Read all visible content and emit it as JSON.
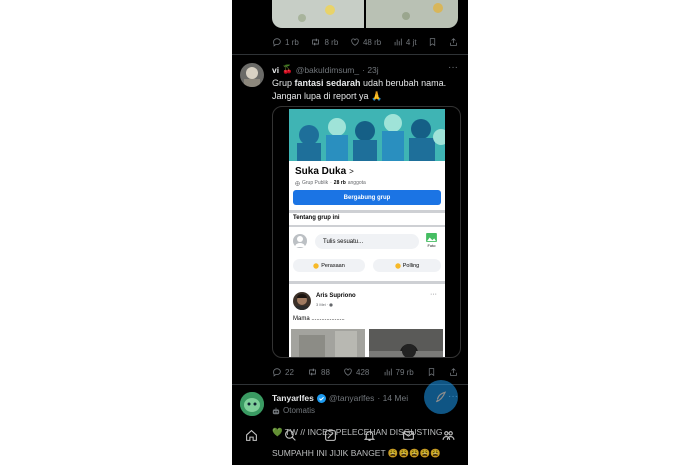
{
  "top_tweet": {
    "actions": {
      "replies": "1 rb",
      "retweets": "8 rb",
      "likes": "48 rb",
      "views": "4 jt"
    }
  },
  "tweet2": {
    "name": "vi",
    "name_emoji": "🍒",
    "handle": "@bakuldimsum_",
    "time": "· 23j",
    "more": "···",
    "text_1": "Grup ",
    "text_bold": "fantasi sedarah",
    "text_2": " udah berubah nama.",
    "text_line2": "Jangan lupa di report ya 🙏",
    "actions": {
      "replies": "22",
      "retweets": "88",
      "likes": "428",
      "views": "79 rb"
    },
    "screenshot": {
      "group_name": "Suka Duka",
      "group_chevron": ">",
      "group_type": "Grup Publik",
      "members": "28 rb",
      "members_label": "anggota",
      "join_button": "Bergabung grup",
      "about": "Tentang grup ini",
      "composer_placeholder": "Tulis sesuatu...",
      "photo_label": "Foto",
      "chip_feeling": "Perasaan",
      "chip_poll": "Polling",
      "post_author": "Aris Supriono",
      "post_time": "3 Mei ·",
      "post_more": "···",
      "post_text": "Mama ...................."
    }
  },
  "tweet3": {
    "name": "Tanyarlfes",
    "handle": "@tanyarlfes",
    "time": "· 14 Mei",
    "more": "···",
    "automated": "Otomatis",
    "text_line1": "💚 TW //  INCES  PELECEHAN DISGUSTING",
    "text_line2": "SUMPAHH INI JIJIK BANGET 😩😩😩😩😩"
  },
  "colors": {
    "background": "#000000",
    "accent": "#1d9bf0",
    "facebook_blue": "#1b74e4",
    "muted": "#71767b"
  },
  "icons": [
    "reply-icon",
    "retweet-icon",
    "like-icon",
    "views-icon",
    "bookmark-icon",
    "share-icon",
    "home-icon",
    "search-icon",
    "grok-icon",
    "notifications-icon",
    "messages-icon",
    "communities-icon",
    "compose-icon",
    "verified-icon",
    "robot-icon"
  ]
}
